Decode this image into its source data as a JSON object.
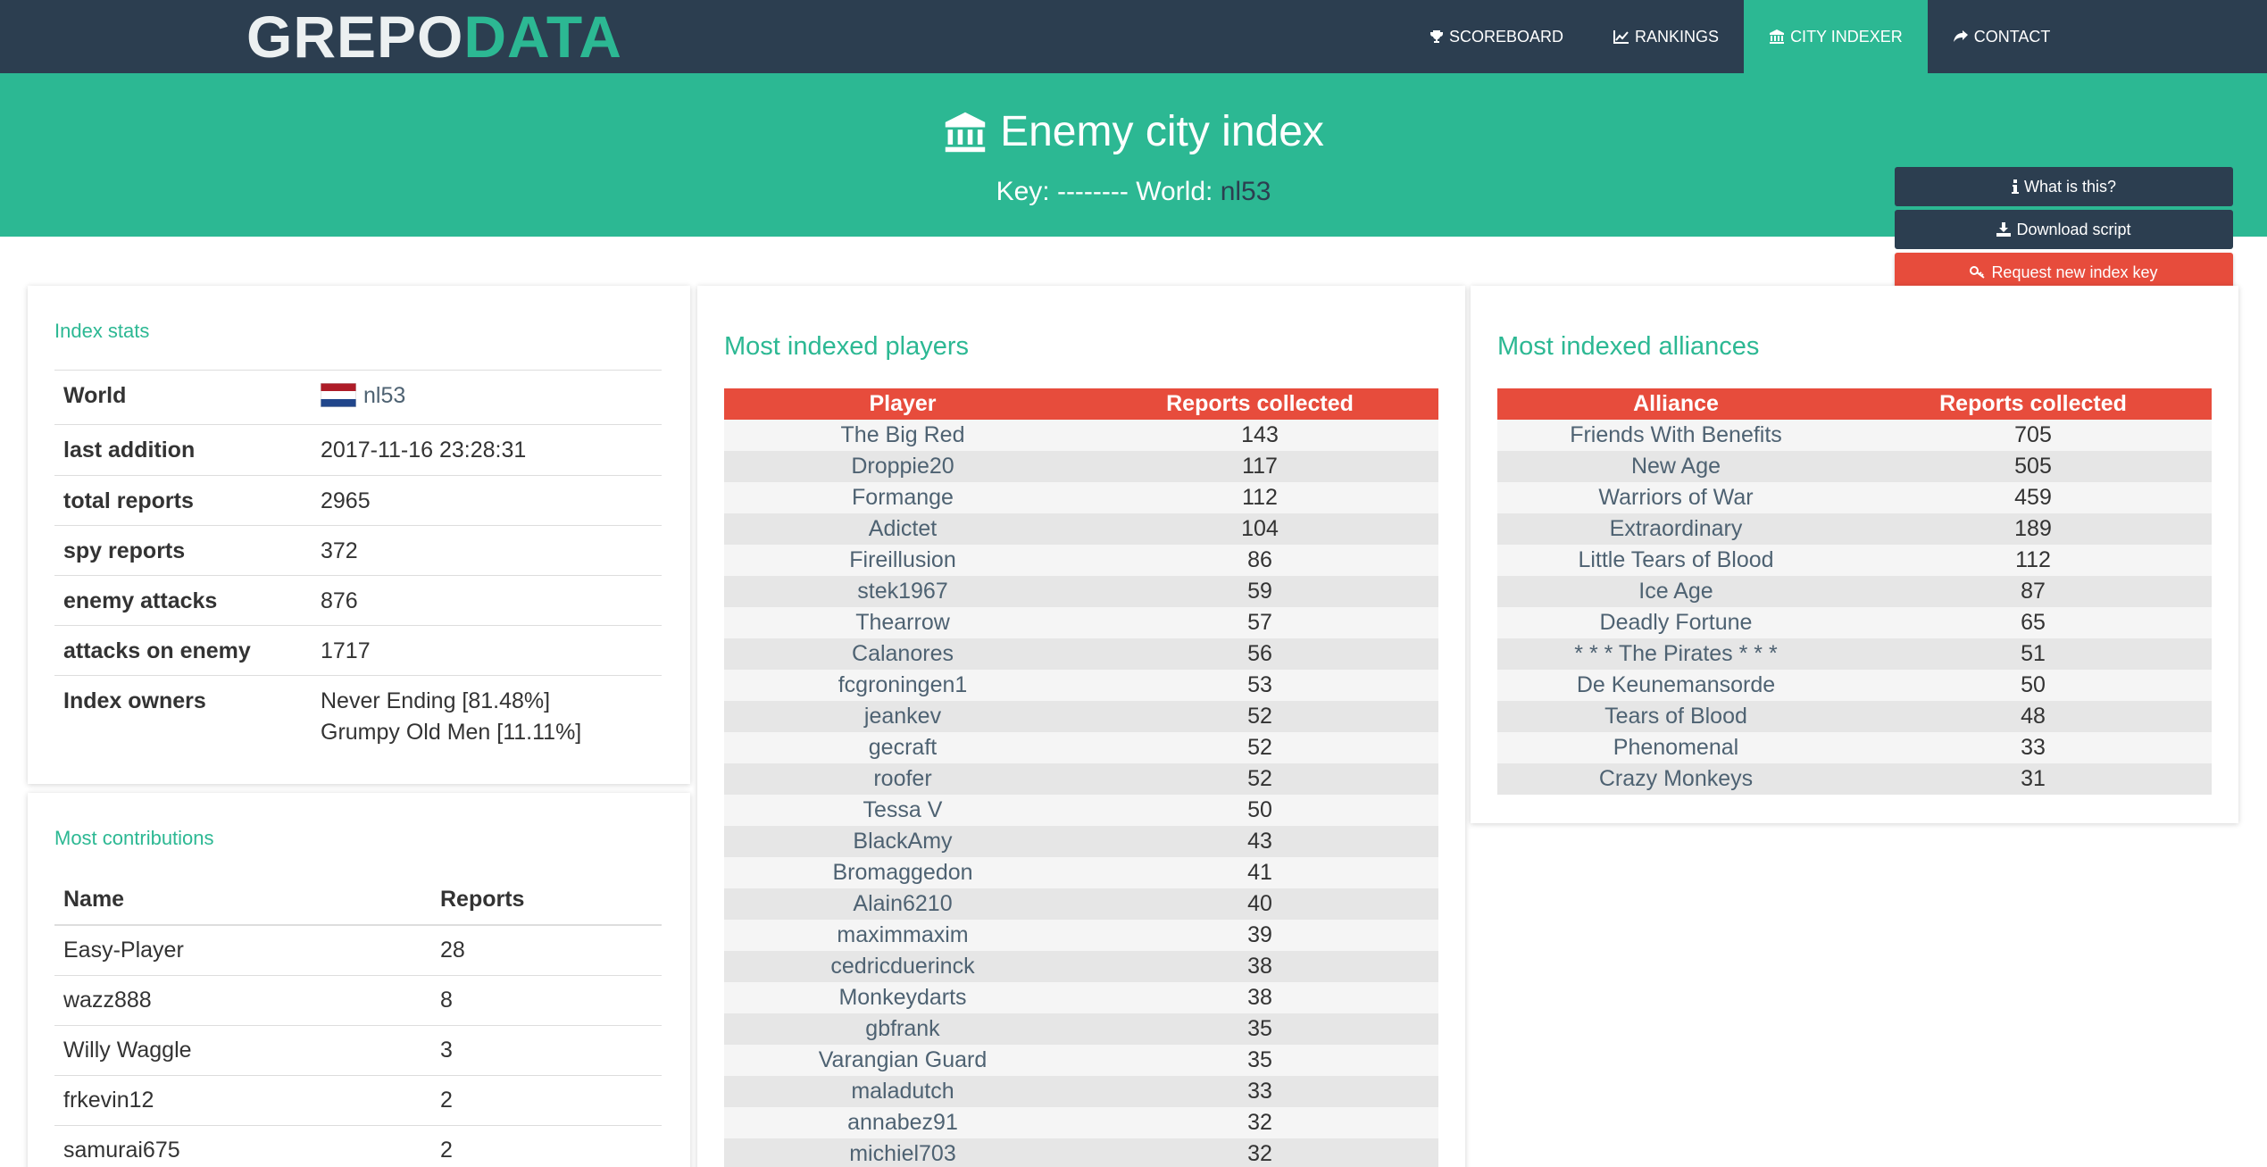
{
  "brand": {
    "part1": "GREPO",
    "part2": "DATA"
  },
  "nav": {
    "items": [
      {
        "label": "SCOREBOARD",
        "icon": "trophy-icon"
      },
      {
        "label": "RANKINGS",
        "icon": "chart-line-icon"
      },
      {
        "label": "CITY INDEXER",
        "icon": "bank-icon",
        "active": true
      },
      {
        "label": "CONTACT",
        "icon": "share-icon"
      }
    ]
  },
  "header": {
    "title": "Enemy city index",
    "key_label": "Key:",
    "key_value": "--------",
    "world_label": "World:",
    "world_value": "nl53",
    "buttons": {
      "what": "What is this?",
      "download": "Download script",
      "request": "Request new index key"
    }
  },
  "index_stats": {
    "title": "Index stats",
    "rows": [
      {
        "label": "World",
        "value": "nl53"
      },
      {
        "label": "last addition",
        "value": "2017-11-16 23:28:31"
      },
      {
        "label": "total reports",
        "value": "2965"
      },
      {
        "label": "spy reports",
        "value": "372"
      },
      {
        "label": "enemy attacks",
        "value": "876"
      },
      {
        "label": "attacks on enemy",
        "value": "1717"
      },
      {
        "label": "Index owners",
        "value": "Never Ending [81.48%]",
        "value2": "Grumpy Old Men [11.11%]"
      }
    ]
  },
  "contributions": {
    "title": "Most contributions",
    "col_name": "Name",
    "col_reports": "Reports",
    "rows": [
      {
        "name": "Easy-Player",
        "reports": "28"
      },
      {
        "name": "wazz888",
        "reports": "8"
      },
      {
        "name": "Willy Waggle",
        "reports": "3"
      },
      {
        "name": "frkevin12",
        "reports": "2"
      },
      {
        "name": "samurai675",
        "reports": "2"
      }
    ]
  },
  "players": {
    "title": "Most indexed players",
    "col_name": "Player",
    "col_count": "Reports collected",
    "rows": [
      {
        "name": "The Big Red",
        "count": "143"
      },
      {
        "name": "Droppie20",
        "count": "117"
      },
      {
        "name": "Formange",
        "count": "112"
      },
      {
        "name": "Adictet",
        "count": "104"
      },
      {
        "name": "Fireillusion",
        "count": "86"
      },
      {
        "name": "stek1967",
        "count": "59"
      },
      {
        "name": "Thearrow",
        "count": "57"
      },
      {
        "name": "Calanores",
        "count": "56"
      },
      {
        "name": "fcgroningen1",
        "count": "53"
      },
      {
        "name": "jeankev",
        "count": "52"
      },
      {
        "name": "gecraft",
        "count": "52"
      },
      {
        "name": "roofer",
        "count": "52"
      },
      {
        "name": "Tessa V",
        "count": "50"
      },
      {
        "name": "BlackAmy",
        "count": "43"
      },
      {
        "name": "Bromaggedon",
        "count": "41"
      },
      {
        "name": "Alain6210",
        "count": "40"
      },
      {
        "name": "maximmaxim",
        "count": "39"
      },
      {
        "name": "cedricduerinck",
        "count": "38"
      },
      {
        "name": "Monkeydarts",
        "count": "38"
      },
      {
        "name": "gbfrank",
        "count": "35"
      },
      {
        "name": "Varangian Guard",
        "count": "35"
      },
      {
        "name": "maladutch",
        "count": "33"
      },
      {
        "name": "annabez91",
        "count": "32"
      },
      {
        "name": "michiel703",
        "count": "32"
      }
    ]
  },
  "alliances": {
    "title": "Most indexed alliances",
    "col_name": "Alliance",
    "col_count": "Reports collected",
    "rows": [
      {
        "name": "Friends With Benefits",
        "count": "705"
      },
      {
        "name": "New Age",
        "count": "505"
      },
      {
        "name": "Warriors of War",
        "count": "459"
      },
      {
        "name": "Extraordinary",
        "count": "189"
      },
      {
        "name": "Little Tears of Blood",
        "count": "112"
      },
      {
        "name": "Ice Age",
        "count": "87"
      },
      {
        "name": "Deadly Fortune",
        "count": "65"
      },
      {
        "name": "* * * The Pirates * * *",
        "count": "51"
      },
      {
        "name": "De Keunemansorde",
        "count": "50"
      },
      {
        "name": "Tears of Blood",
        "count": "48"
      },
      {
        "name": "Phenomenal",
        "count": "33"
      },
      {
        "name": "Crazy Monkeys",
        "count": "31"
      }
    ]
  },
  "colors": {
    "navbar": "#2c3e50",
    "accent": "#2cb893",
    "danger": "#e74c3c"
  }
}
